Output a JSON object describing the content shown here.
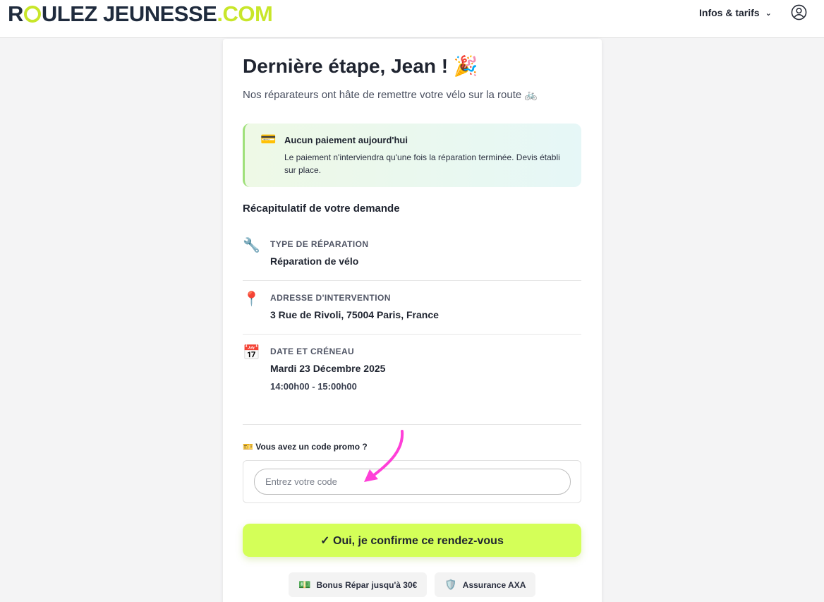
{
  "header": {
    "logo_main": "ROULEZ JEUNESSE",
    "logo_domain": ".COM",
    "menu_label": "Infos & tarifs",
    "menu_chevron": "⌄",
    "user_icon": "user-circle-icon"
  },
  "page": {
    "title": "Dernière étape, Jean ! 🎉",
    "subtitle": "Nos réparateurs ont hâte de remettre votre vélo sur la route 🚲"
  },
  "info": {
    "icon": "💳",
    "title": "Aucun paiement aujourd'hui",
    "text": "Le paiement n'interviendra qu'une fois la réparation terminée. Devis établi sur place."
  },
  "recap": {
    "title": "Récapitulatif de votre demande",
    "items": [
      {
        "icon": "🔧",
        "label": "TYPE DE RÉPARATION",
        "value": "Réparation de vélo",
        "sub": ""
      },
      {
        "icon": "📍",
        "label": "ADRESSE D'INTERVENTION",
        "value": "3 Rue de Rivoli, 75004 Paris, France",
        "sub": ""
      },
      {
        "icon": "📅",
        "label": "DATE ET CRÉNEAU",
        "value": "Mardi 23 Décembre 2025",
        "sub": "14:00h00 - 15:00h00"
      }
    ]
  },
  "promo": {
    "label": "🎫 Vous avez un code promo ?",
    "placeholder": "Entrez votre code",
    "value": ""
  },
  "confirm": {
    "label": "✓ Oui, je confirme ce rendez-vous"
  },
  "badges": [
    {
      "icon": "💵",
      "label": "Bonus Répar jusqu'à 30€"
    },
    {
      "icon": "🛡️",
      "label": "Assurance AXA"
    }
  ],
  "colors": {
    "accent": "#d4ff58",
    "brand_green": "#c8e62a",
    "annotation_arrow": "#ff3fd8"
  }
}
